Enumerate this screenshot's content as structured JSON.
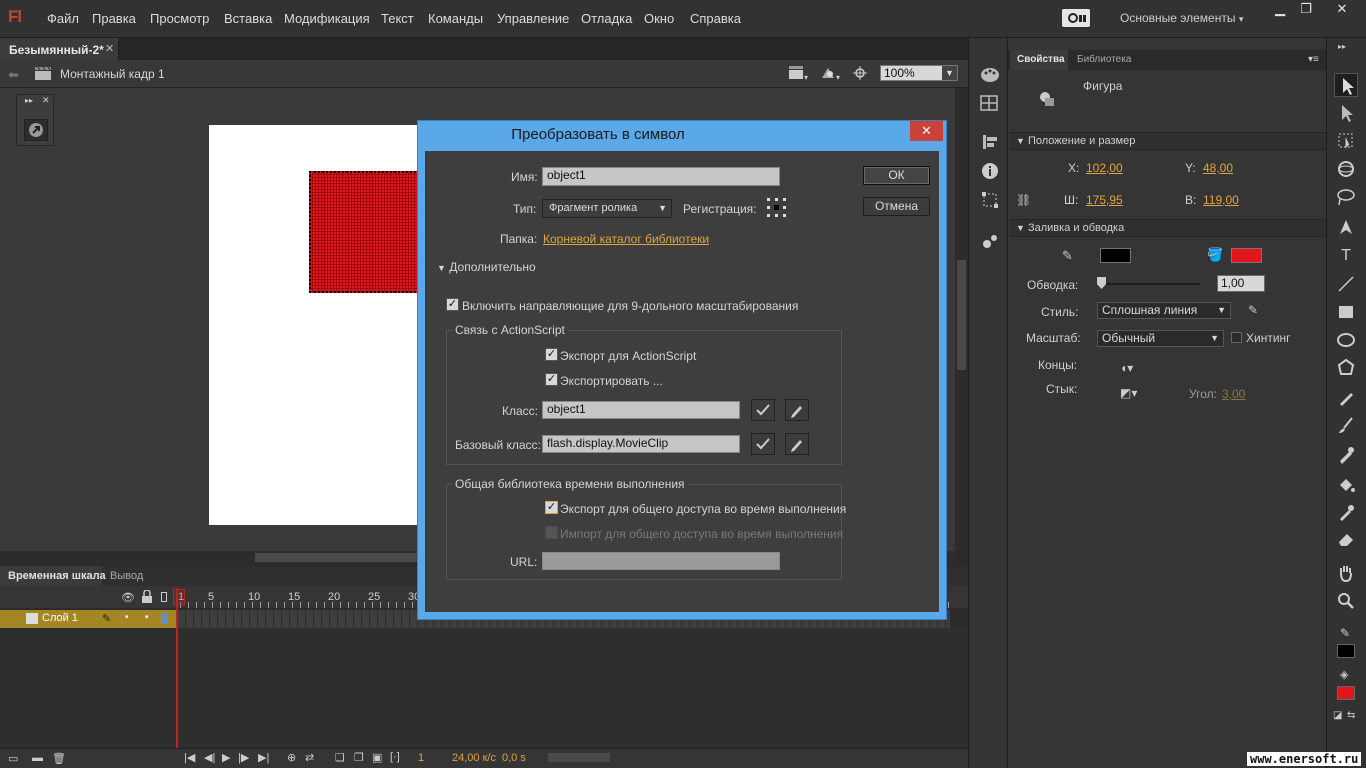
{
  "app": {
    "logo": "Fl"
  },
  "menu": [
    "Файл",
    "Правка",
    "Просмотр",
    "Вставка",
    "Модификация",
    "Текст",
    "Команды",
    "Управление",
    "Отладка",
    "Окно",
    "Справка"
  ],
  "workspace": {
    "label": "Основные элементы"
  },
  "document": {
    "tab": "Безымянный-2*",
    "scene": "Монтажный кадр 1",
    "zoom": "100%"
  },
  "timeline": {
    "tabs": [
      "Временная шкала",
      "Вывод"
    ],
    "frame_numbers": [
      "1",
      "5",
      "10",
      "15",
      "20",
      "25",
      "30"
    ],
    "layer": "Слой 1",
    "current_frame": "1",
    "fps": "24,00 к/с",
    "time": "0,0 s"
  },
  "properties": {
    "tabs": [
      "Свойства",
      "Библиотека"
    ],
    "object_type": "Фигура",
    "position": {
      "header": "Положение и размер",
      "x_label": "X:",
      "x": "102,00",
      "y_label": "Y:",
      "y": "48,00",
      "w_label": "Ш:",
      "w": "175,95",
      "h_label": "В:",
      "h": "119,00"
    },
    "fill": {
      "header": "Заливка и обводка",
      "stroke_color": "#000000",
      "fill_color": "#e0161c",
      "stroke_label": "Обводка:",
      "stroke_value": "1,00",
      "style_label": "Стиль:",
      "style_value": "Сплошная линия",
      "scale_label": "Масштаб:",
      "scale_value": "Обычный",
      "hinting_label": "Хинтинг",
      "caps_label": "Концы:",
      "joins_label": "Стык:",
      "angle_label": "Угол:",
      "angle_value": "3,00"
    }
  },
  "dialog": {
    "title": "Преобразовать в символ",
    "name_label": "Имя:",
    "name_value": "object1",
    "type_label": "Тип:",
    "type_value": "Фрагмент ролика",
    "registration_label": "Регистрация:",
    "folder_label": "Папка:",
    "folder_value": "Корневой каталог библиотеки",
    "advanced_label": "Дополнительно",
    "scale9_label": "Включить направляющие для 9-дольного масштабирования",
    "actionscript": {
      "group_label": "Связь с ActionScript",
      "export_as_label": "Экспорт для ActionScript",
      "export_frame_label": "Экспортировать ...",
      "class_label": "Класс:",
      "class_value": "object1",
      "base_class_label": "Базовый класс:",
      "base_class_value": "flash.display.MovieClip"
    },
    "runtime": {
      "group_label": "Общая библиотека времени выполнения",
      "export_label": "Экспорт для общего доступа во время выполнения",
      "import_label": "Импорт для общего доступа во время выполнения",
      "url_label": "URL:",
      "url_value": ""
    },
    "ok_label": "ОК",
    "cancel_label": "Отмена"
  },
  "watermark": "www.enersoft.ru"
}
